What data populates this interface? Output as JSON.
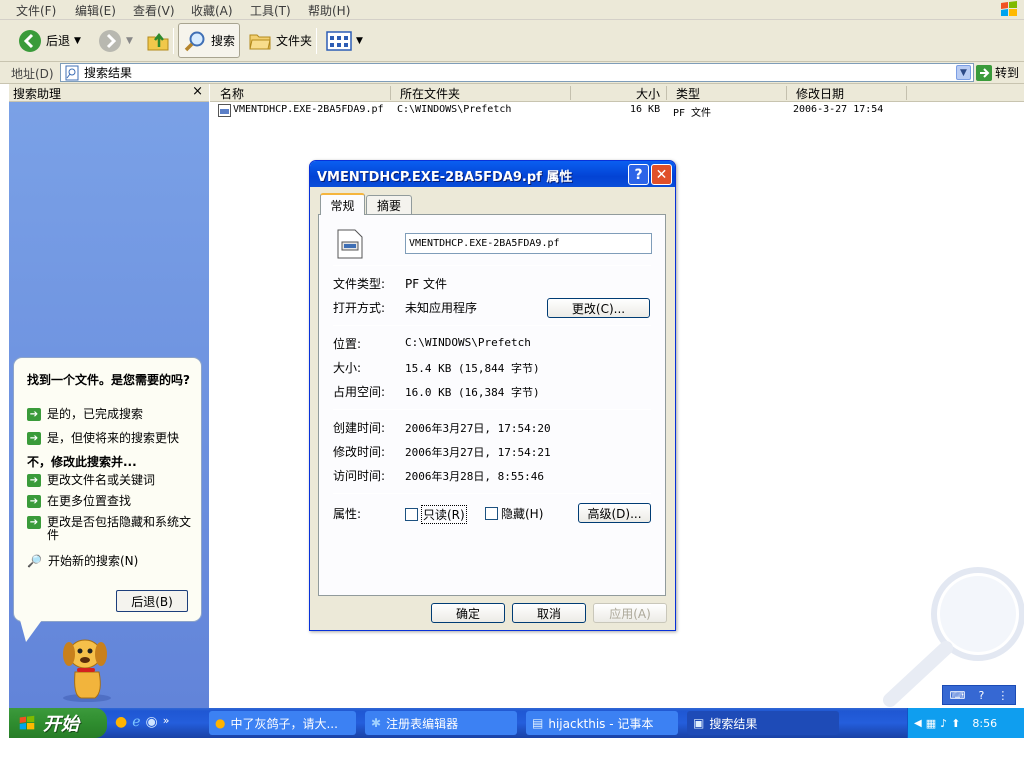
{
  "menu": [
    "文件(F)",
    "编辑(E)",
    "查看(V)",
    "收藏(A)",
    "工具(T)",
    "帮助(H)"
  ],
  "toolbar": {
    "back": "后退",
    "search": "搜索",
    "folders": "文件夹"
  },
  "address": {
    "label": "地址(D)",
    "value": "搜索结果",
    "go": "转到"
  },
  "search_pane": {
    "title": "搜索助理",
    "close": "×",
    "question": "找到一个文件。是您需要的吗?",
    "yes_done": "是的，已完成搜索",
    "yes_faster": "是，但使将来的搜索更快",
    "no_refine": "不，修改此搜索并...",
    "change_name": "更改文件名或关键词",
    "more_locations": "在更多位置查找",
    "hidden_system": "更改是否包括隐藏和系统文件",
    "new_search": "开始新的搜索(N)",
    "back_button": "后退(B)"
  },
  "list": {
    "columns": [
      "名称",
      "所在文件夹",
      "大小",
      "类型",
      "修改日期"
    ],
    "rows": [
      {
        "name": "VMENTDHCP.EXE-2BA5FDA9.pf",
        "folder": "C:\\WINDOWS\\Prefetch",
        "size": "16 KB",
        "type": "PF 文件",
        "modified": "2006-3-27 17:54"
      }
    ]
  },
  "dialog": {
    "title": "VMENTDHCP.EXE-2BA5FDA9.pf 属性",
    "help": "?",
    "close": "✕",
    "tabs": [
      "常规",
      "摘要"
    ],
    "filename": "VMENTDHCP.EXE-2BA5FDA9.pf",
    "type_label": "文件类型:",
    "type_value": "PF 文件",
    "opens_label": "打开方式:",
    "opens_value": "未知应用程序",
    "change_btn": "更改(C)...",
    "location_label": "位置:",
    "location_value": "C:\\WINDOWS\\Prefetch",
    "size_label": "大小:",
    "size_value": "15.4 KB (15,844 字节)",
    "disk_label": "占用空间:",
    "disk_value": "16.0 KB (16,384 字节)",
    "created_label": "创建时间:",
    "created_value": "2006年3月27日, 17:54:20",
    "modified_label": "修改时间:",
    "modified_value": "2006年3月27日, 17:54:21",
    "accessed_label": "访问时间:",
    "accessed_value": "2006年3月28日, 8:55:46",
    "attr_label": "属性:",
    "readonly": "只读(R)",
    "hidden": "隐藏(H)",
    "advanced_btn": "高级(D)...",
    "ok": "确定",
    "cancel": "取消",
    "apply": "应用(A)"
  },
  "taskbar": {
    "start": "开始",
    "tasks": [
      "中了灰鸽子，请大...",
      "注册表编辑器",
      "hijackthis - 记事本",
      "搜索结果"
    ],
    "clock": "8:56"
  },
  "colors": {
    "title_blue": "#0a5ff1",
    "pane_blue": "#7ba2e7",
    "start_green": "#3c9a3c",
    "taskbar_blue": "#245edc"
  }
}
